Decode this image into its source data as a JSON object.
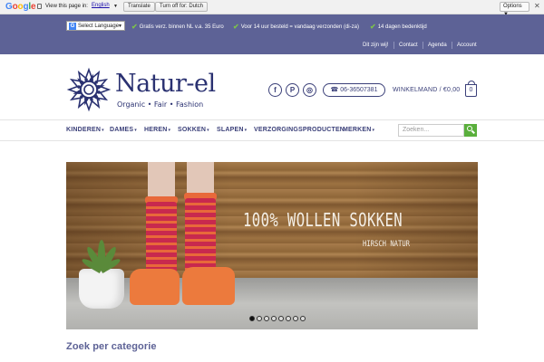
{
  "translate_bar": {
    "logo": [
      "G",
      "o",
      "o",
      "g",
      "l",
      "e"
    ],
    "view_text": "View this page in:",
    "language": "English",
    "translate_button": "Translate",
    "turn_off_button": "Turn off for: Dutch",
    "options_button": "Options ▼",
    "close": "✕"
  },
  "topbar": {
    "select_language": "Select Language",
    "usps": [
      "Gratis verz. binnen NL v.a. 35 Euro",
      "Voor 14 uur besteld = vandaag verzonden (di-za)",
      "14 dagen bedenktijd"
    ],
    "links": [
      "Dit zijn wij!",
      "Contact",
      "Agenda",
      "Account"
    ]
  },
  "header": {
    "logo_name": "Natur-el",
    "logo_tagline": "Organic • Fair • Fashion",
    "social_icons": [
      "facebook-icon",
      "pinterest-icon",
      "instagram-icon"
    ],
    "social_glyphs": [
      "f",
      "P",
      "◎"
    ],
    "phone_icon": "☎",
    "phone": "06-36507381",
    "cart_label": "WINKELMAND / €0,00",
    "cart_count": "0"
  },
  "nav": {
    "items": [
      "KINDEREN",
      "DAMES",
      "HEREN",
      "SOKKEN",
      "SLAPEN",
      "VERZORGINGSPRODUCTEN",
      "MERKEN"
    ],
    "chevron": "▾",
    "search_placeholder": "Zoeken..."
  },
  "banner": {
    "headline": "100% WOLLEN SOKKEN",
    "subline": "HIRSCH NATUR",
    "slide_count": 8,
    "active_slide": 1
  },
  "section": {
    "title": "Zoek per categorie"
  },
  "colors": {
    "topbar": "#5d6296",
    "brand": "#2a3171",
    "accent_green": "#5aaf3c"
  }
}
